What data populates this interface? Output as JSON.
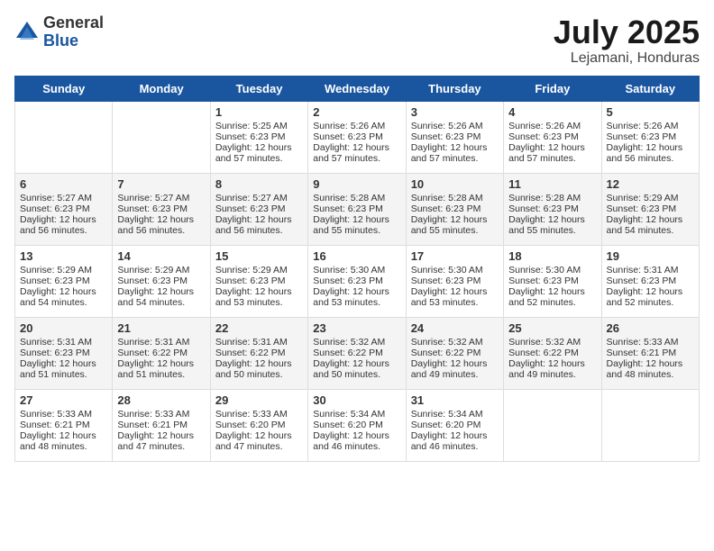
{
  "logo": {
    "general": "General",
    "blue": "Blue"
  },
  "title": "July 2025",
  "location": "Lejamani, Honduras",
  "days_of_week": [
    "Sunday",
    "Monday",
    "Tuesday",
    "Wednesday",
    "Thursday",
    "Friday",
    "Saturday"
  ],
  "weeks": [
    [
      {
        "day": "",
        "sunrise": "",
        "sunset": "",
        "daylight": ""
      },
      {
        "day": "",
        "sunrise": "",
        "sunset": "",
        "daylight": ""
      },
      {
        "day": "1",
        "sunrise": "Sunrise: 5:25 AM",
        "sunset": "Sunset: 6:23 PM",
        "daylight": "Daylight: 12 hours and 57 minutes."
      },
      {
        "day": "2",
        "sunrise": "Sunrise: 5:26 AM",
        "sunset": "Sunset: 6:23 PM",
        "daylight": "Daylight: 12 hours and 57 minutes."
      },
      {
        "day": "3",
        "sunrise": "Sunrise: 5:26 AM",
        "sunset": "Sunset: 6:23 PM",
        "daylight": "Daylight: 12 hours and 57 minutes."
      },
      {
        "day": "4",
        "sunrise": "Sunrise: 5:26 AM",
        "sunset": "Sunset: 6:23 PM",
        "daylight": "Daylight: 12 hours and 57 minutes."
      },
      {
        "day": "5",
        "sunrise": "Sunrise: 5:26 AM",
        "sunset": "Sunset: 6:23 PM",
        "daylight": "Daylight: 12 hours and 56 minutes."
      }
    ],
    [
      {
        "day": "6",
        "sunrise": "Sunrise: 5:27 AM",
        "sunset": "Sunset: 6:23 PM",
        "daylight": "Daylight: 12 hours and 56 minutes."
      },
      {
        "day": "7",
        "sunrise": "Sunrise: 5:27 AM",
        "sunset": "Sunset: 6:23 PM",
        "daylight": "Daylight: 12 hours and 56 minutes."
      },
      {
        "day": "8",
        "sunrise": "Sunrise: 5:27 AM",
        "sunset": "Sunset: 6:23 PM",
        "daylight": "Daylight: 12 hours and 56 minutes."
      },
      {
        "day": "9",
        "sunrise": "Sunrise: 5:28 AM",
        "sunset": "Sunset: 6:23 PM",
        "daylight": "Daylight: 12 hours and 55 minutes."
      },
      {
        "day": "10",
        "sunrise": "Sunrise: 5:28 AM",
        "sunset": "Sunset: 6:23 PM",
        "daylight": "Daylight: 12 hours and 55 minutes."
      },
      {
        "day": "11",
        "sunrise": "Sunrise: 5:28 AM",
        "sunset": "Sunset: 6:23 PM",
        "daylight": "Daylight: 12 hours and 55 minutes."
      },
      {
        "day": "12",
        "sunrise": "Sunrise: 5:29 AM",
        "sunset": "Sunset: 6:23 PM",
        "daylight": "Daylight: 12 hours and 54 minutes."
      }
    ],
    [
      {
        "day": "13",
        "sunrise": "Sunrise: 5:29 AM",
        "sunset": "Sunset: 6:23 PM",
        "daylight": "Daylight: 12 hours and 54 minutes."
      },
      {
        "day": "14",
        "sunrise": "Sunrise: 5:29 AM",
        "sunset": "Sunset: 6:23 PM",
        "daylight": "Daylight: 12 hours and 54 minutes."
      },
      {
        "day": "15",
        "sunrise": "Sunrise: 5:29 AM",
        "sunset": "Sunset: 6:23 PM",
        "daylight": "Daylight: 12 hours and 53 minutes."
      },
      {
        "day": "16",
        "sunrise": "Sunrise: 5:30 AM",
        "sunset": "Sunset: 6:23 PM",
        "daylight": "Daylight: 12 hours and 53 minutes."
      },
      {
        "day": "17",
        "sunrise": "Sunrise: 5:30 AM",
        "sunset": "Sunset: 6:23 PM",
        "daylight": "Daylight: 12 hours and 53 minutes."
      },
      {
        "day": "18",
        "sunrise": "Sunrise: 5:30 AM",
        "sunset": "Sunset: 6:23 PM",
        "daylight": "Daylight: 12 hours and 52 minutes."
      },
      {
        "day": "19",
        "sunrise": "Sunrise: 5:31 AM",
        "sunset": "Sunset: 6:23 PM",
        "daylight": "Daylight: 12 hours and 52 minutes."
      }
    ],
    [
      {
        "day": "20",
        "sunrise": "Sunrise: 5:31 AM",
        "sunset": "Sunset: 6:23 PM",
        "daylight": "Daylight: 12 hours and 51 minutes."
      },
      {
        "day": "21",
        "sunrise": "Sunrise: 5:31 AM",
        "sunset": "Sunset: 6:22 PM",
        "daylight": "Daylight: 12 hours and 51 minutes."
      },
      {
        "day": "22",
        "sunrise": "Sunrise: 5:31 AM",
        "sunset": "Sunset: 6:22 PM",
        "daylight": "Daylight: 12 hours and 50 minutes."
      },
      {
        "day": "23",
        "sunrise": "Sunrise: 5:32 AM",
        "sunset": "Sunset: 6:22 PM",
        "daylight": "Daylight: 12 hours and 50 minutes."
      },
      {
        "day": "24",
        "sunrise": "Sunrise: 5:32 AM",
        "sunset": "Sunset: 6:22 PM",
        "daylight": "Daylight: 12 hours and 49 minutes."
      },
      {
        "day": "25",
        "sunrise": "Sunrise: 5:32 AM",
        "sunset": "Sunset: 6:22 PM",
        "daylight": "Daylight: 12 hours and 49 minutes."
      },
      {
        "day": "26",
        "sunrise": "Sunrise: 5:33 AM",
        "sunset": "Sunset: 6:21 PM",
        "daylight": "Daylight: 12 hours and 48 minutes."
      }
    ],
    [
      {
        "day": "27",
        "sunrise": "Sunrise: 5:33 AM",
        "sunset": "Sunset: 6:21 PM",
        "daylight": "Daylight: 12 hours and 48 minutes."
      },
      {
        "day": "28",
        "sunrise": "Sunrise: 5:33 AM",
        "sunset": "Sunset: 6:21 PM",
        "daylight": "Daylight: 12 hours and 47 minutes."
      },
      {
        "day": "29",
        "sunrise": "Sunrise: 5:33 AM",
        "sunset": "Sunset: 6:20 PM",
        "daylight": "Daylight: 12 hours and 47 minutes."
      },
      {
        "day": "30",
        "sunrise": "Sunrise: 5:34 AM",
        "sunset": "Sunset: 6:20 PM",
        "daylight": "Daylight: 12 hours and 46 minutes."
      },
      {
        "day": "31",
        "sunrise": "Sunrise: 5:34 AM",
        "sunset": "Sunset: 6:20 PM",
        "daylight": "Daylight: 12 hours and 46 minutes."
      },
      {
        "day": "",
        "sunrise": "",
        "sunset": "",
        "daylight": ""
      },
      {
        "day": "",
        "sunrise": "",
        "sunset": "",
        "daylight": ""
      }
    ]
  ]
}
